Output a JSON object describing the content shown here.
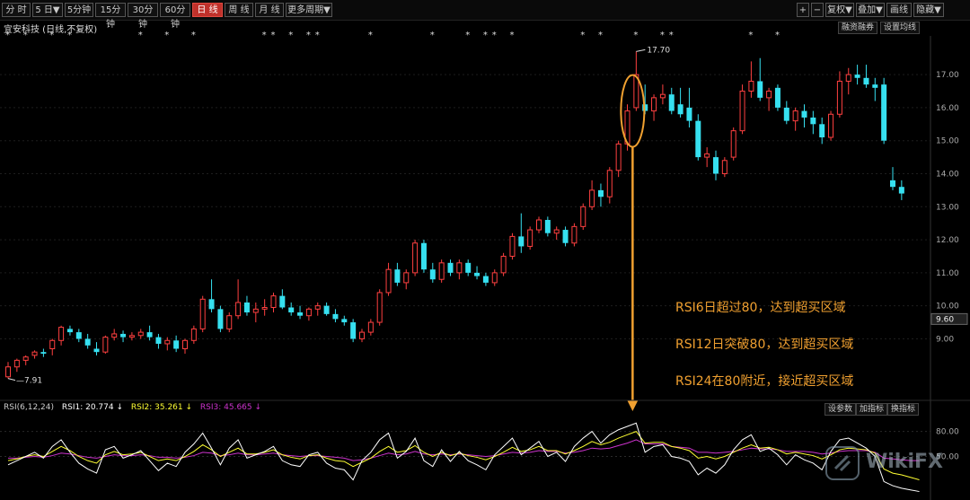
{
  "toolbar": {
    "tabs": [
      "分 时",
      "5 日▼",
      "5分钟",
      "15分钟",
      "30分钟",
      "60分钟",
      "日 线",
      "周 线",
      "月 线",
      "更多周期▼"
    ],
    "active_tab": "日 线",
    "right_buttons": [
      "+",
      "−",
      "复权▼",
      "叠加▼",
      "画线",
      "隐藏▼"
    ]
  },
  "stock_title": "宜安科技 (日线,不复权)",
  "right_tools": [
    "融资融券",
    "设置均线"
  ],
  "rsi_tools": [
    "设参数",
    "加指标",
    "换指标"
  ],
  "annotations": [
    "RSI6日超过80，达到超买区域",
    "RSI12日突破80，达到超买区域",
    "RSI24在80附近，接近超买区域"
  ],
  "rsi_header": {
    "name": "RSI(6,12,24)",
    "rsi1": "RSI1: 20.774 ↓",
    "rsi2": "RSI2: 35.261 ↓",
    "rsi3": "RSI3: 45.665 ↓"
  },
  "watermark": "WikiFX",
  "colors": {
    "up": "#ff4040",
    "down": "#36e0f0",
    "rsi1": "#ffffff",
    "rsi2": "#ffff33",
    "rsi3": "#cc33cc",
    "annotation": "#f0a030"
  },
  "chart_data": {
    "type": "candlestick",
    "ylim": [
      7.3,
      17.9
    ],
    "yticks": [
      "17.00",
      "16.00",
      "15.00",
      "14.00",
      "13.00",
      "12.00",
      "11.00",
      "10.00",
      "9.00"
    ],
    "current_price_label": "9.60",
    "high_label": "17.70",
    "low_label": "7.91",
    "ohlc": [
      [
        7.85,
        8.3,
        7.8,
        8.15
      ],
      [
        8.15,
        8.4,
        8.0,
        8.35
      ],
      [
        8.35,
        8.5,
        8.2,
        8.45
      ],
      [
        8.5,
        8.65,
        8.4,
        8.6
      ],
      [
        8.6,
        8.7,
        8.45,
        8.55
      ],
      [
        8.7,
        9.0,
        8.5,
        8.95
      ],
      [
        8.95,
        9.4,
        8.8,
        9.35
      ],
      [
        9.3,
        9.4,
        9.1,
        9.2
      ],
      [
        9.2,
        9.3,
        8.9,
        9.0
      ],
      [
        9.0,
        9.15,
        8.7,
        8.8
      ],
      [
        8.7,
        8.9,
        8.5,
        8.6
      ],
      [
        8.6,
        9.1,
        8.55,
        9.05
      ],
      [
        9.05,
        9.3,
        8.95,
        9.15
      ],
      [
        9.15,
        9.25,
        8.9,
        9.05
      ],
      [
        9.05,
        9.2,
        8.95,
        9.1
      ],
      [
        9.1,
        9.3,
        9.0,
        9.2
      ],
      [
        9.2,
        9.4,
        8.95,
        9.05
      ],
      [
        9.05,
        9.15,
        8.7,
        8.85
      ],
      [
        8.85,
        9.05,
        8.65,
        8.95
      ],
      [
        8.95,
        9.1,
        8.6,
        8.7
      ],
      [
        8.7,
        9.0,
        8.55,
        8.95
      ],
      [
        8.95,
        9.4,
        8.85,
        9.3
      ],
      [
        9.3,
        10.3,
        9.2,
        10.2
      ],
      [
        10.2,
        10.8,
        9.8,
        9.9
      ],
      [
        9.9,
        10.0,
        9.2,
        9.3
      ],
      [
        9.3,
        9.8,
        9.2,
        9.7
      ],
      [
        9.7,
        10.8,
        9.6,
        10.1
      ],
      [
        10.1,
        10.3,
        9.7,
        9.8
      ],
      [
        9.8,
        10.1,
        9.5,
        9.9
      ],
      [
        9.9,
        10.2,
        9.7,
        9.95
      ],
      [
        9.95,
        10.4,
        9.8,
        10.3
      ],
      [
        10.3,
        10.5,
        9.9,
        9.95
      ],
      [
        9.95,
        10.1,
        9.7,
        9.8
      ],
      [
        9.8,
        10.0,
        9.6,
        9.7
      ],
      [
        9.7,
        9.95,
        9.55,
        9.9
      ],
      [
        9.9,
        10.1,
        9.7,
        10.0
      ],
      [
        10.0,
        10.1,
        9.7,
        9.75
      ],
      [
        9.75,
        9.9,
        9.5,
        9.6
      ],
      [
        9.6,
        9.7,
        9.4,
        9.5
      ],
      [
        9.5,
        9.6,
        8.9,
        9.0
      ],
      [
        9.0,
        9.3,
        8.9,
        9.2
      ],
      [
        9.2,
        9.6,
        9.1,
        9.5
      ],
      [
        9.5,
        10.5,
        9.4,
        10.4
      ],
      [
        10.4,
        11.3,
        10.3,
        11.1
      ],
      [
        11.1,
        11.3,
        10.6,
        10.7
      ],
      [
        10.7,
        11.1,
        10.5,
        11.0
      ],
      [
        11.0,
        12.0,
        10.9,
        11.9
      ],
      [
        11.9,
        12.0,
        11.0,
        11.1
      ],
      [
        11.1,
        11.3,
        10.7,
        10.8
      ],
      [
        10.8,
        11.4,
        10.7,
        11.3
      ],
      [
        11.3,
        11.4,
        10.9,
        11.0
      ],
      [
        11.0,
        11.4,
        10.8,
        11.3
      ],
      [
        11.3,
        11.4,
        10.9,
        11.0
      ],
      [
        11.0,
        11.2,
        10.8,
        10.9
      ],
      [
        10.9,
        11.0,
        10.6,
        10.7
      ],
      [
        10.7,
        11.1,
        10.6,
        11.0
      ],
      [
        11.0,
        11.6,
        10.9,
        11.5
      ],
      [
        11.5,
        12.2,
        11.4,
        12.1
      ],
      [
        12.1,
        12.8,
        11.6,
        11.8
      ],
      [
        11.8,
        12.4,
        11.7,
        12.3
      ],
      [
        12.3,
        12.7,
        12.2,
        12.6
      ],
      [
        12.6,
        12.7,
        12.1,
        12.2
      ],
      [
        12.2,
        12.4,
        12.0,
        12.3
      ],
      [
        12.3,
        12.4,
        11.8,
        11.9
      ],
      [
        11.9,
        12.5,
        11.8,
        12.4
      ],
      [
        12.4,
        13.1,
        12.3,
        13.0
      ],
      [
        13.0,
        13.8,
        12.9,
        13.5
      ],
      [
        13.5,
        13.7,
        13.0,
        13.3
      ],
      [
        13.3,
        14.2,
        13.1,
        14.1
      ],
      [
        14.1,
        15.0,
        13.9,
        14.9
      ],
      [
        14.9,
        16.1,
        14.7,
        15.9
      ],
      [
        16.0,
        17.7,
        15.9,
        17.0
      ],
      [
        16.1,
        16.7,
        15.8,
        15.9
      ],
      [
        15.9,
        16.4,
        15.6,
        16.3
      ],
      [
        16.3,
        16.7,
        16.1,
        16.4
      ],
      [
        16.4,
        16.6,
        15.8,
        15.9
      ],
      [
        16.1,
        16.6,
        15.7,
        15.8
      ],
      [
        16.0,
        16.6,
        15.4,
        15.6
      ],
      [
        15.6,
        15.8,
        14.4,
        14.5
      ],
      [
        14.5,
        14.8,
        14.2,
        14.6
      ],
      [
        14.5,
        14.7,
        13.8,
        14.0
      ],
      [
        14.0,
        14.5,
        13.9,
        14.4
      ],
      [
        14.5,
        15.4,
        14.4,
        15.3
      ],
      [
        15.3,
        16.7,
        15.2,
        16.5
      ],
      [
        16.5,
        17.4,
        16.3,
        16.8
      ],
      [
        16.8,
        17.5,
        16.2,
        16.3
      ],
      [
        16.3,
        16.6,
        15.9,
        16.5
      ],
      [
        16.6,
        16.7,
        15.9,
        16.0
      ],
      [
        16.0,
        16.2,
        15.5,
        15.6
      ],
      [
        15.6,
        16.0,
        15.3,
        15.9
      ],
      [
        15.9,
        16.1,
        15.4,
        15.7
      ],
      [
        15.7,
        15.9,
        15.2,
        15.5
      ],
      [
        15.5,
        15.7,
        14.9,
        15.1
      ],
      [
        15.1,
        15.9,
        15.0,
        15.8
      ],
      [
        15.8,
        17.1,
        15.7,
        16.8
      ],
      [
        16.8,
        17.2,
        16.4,
        17.0
      ],
      [
        17.0,
        17.3,
        16.7,
        16.9
      ],
      [
        16.9,
        17.3,
        16.6,
        16.7
      ],
      [
        16.7,
        16.9,
        16.2,
        16.6
      ],
      [
        16.7,
        16.9,
        14.9,
        15.0
      ],
      [
        13.8,
        14.2,
        13.5,
        13.6
      ],
      [
        13.6,
        13.8,
        13.2,
        13.4
      ]
    ],
    "rsi1": [
      40,
      45,
      50,
      55,
      48,
      62,
      70,
      55,
      42,
      35,
      30,
      58,
      62,
      48,
      52,
      57,
      45,
      33,
      42,
      38,
      55,
      65,
      78,
      60,
      40,
      60,
      70,
      48,
      52,
      56,
      62,
      45,
      40,
      38,
      52,
      55,
      42,
      36,
      34,
      22,
      45,
      55,
      70,
      78,
      48,
      56,
      72,
      45,
      38,
      58,
      44,
      56,
      45,
      40,
      34,
      52,
      62,
      72,
      52,
      60,
      68,
      50,
      55,
      44,
      62,
      72,
      80,
      66,
      76,
      82,
      86,
      90,
      55,
      62,
      64,
      50,
      48,
      44,
      28,
      36,
      30,
      40,
      58,
      70,
      76,
      56,
      60,
      52,
      40,
      52,
      46,
      42,
      34,
      56,
      70,
      72,
      66,
      60,
      50,
      20,
      15,
      12,
      10,
      8
    ],
    "rsi2": [
      45,
      47,
      50,
      52,
      50,
      56,
      62,
      57,
      50,
      45,
      42,
      52,
      56,
      52,
      53,
      55,
      50,
      45,
      47,
      45,
      50,
      56,
      64,
      58,
      50,
      55,
      60,
      53,
      53,
      55,
      58,
      52,
      49,
      47,
      51,
      52,
      48,
      45,
      44,
      38,
      43,
      48,
      56,
      62,
      55,
      57,
      63,
      55,
      50,
      55,
      51,
      54,
      51,
      49,
      46,
      50,
      55,
      61,
      56,
      58,
      62,
      57,
      57,
      53,
      57,
      62,
      68,
      64,
      67,
      72,
      76,
      80,
      66,
      67,
      67,
      62,
      60,
      57,
      48,
      50,
      47,
      50,
      55,
      60,
      64,
      60,
      61,
      58,
      53,
      55,
      53,
      51,
      47,
      52,
      58,
      60,
      59,
      58,
      54,
      35,
      30,
      28,
      25,
      22
    ],
    "rsi3": [
      48,
      48,
      49,
      50,
      49,
      51,
      54,
      53,
      51,
      49,
      48,
      50,
      52,
      51,
      51,
      52,
      51,
      49,
      49,
      48,
      49,
      51,
      55,
      54,
      51,
      52,
      54,
      52,
      52,
      53,
      54,
      52,
      51,
      50,
      51,
      51,
      50,
      49,
      48,
      45,
      46,
      48,
      51,
      54,
      52,
      53,
      56,
      53,
      52,
      53,
      52,
      53,
      52,
      51,
      50,
      51,
      53,
      55,
      54,
      55,
      57,
      56,
      56,
      54,
      55,
      57,
      60,
      59,
      60,
      63,
      66,
      70,
      65,
      65,
      65,
      62,
      61,
      60,
      55,
      55,
      54,
      55,
      56,
      58,
      60,
      59,
      59,
      58,
      56,
      56,
      56,
      55,
      53,
      54,
      56,
      57,
      57,
      57,
      55,
      48,
      47,
      46,
      45,
      45
    ],
    "rsi_ylim": [
      0,
      100
    ],
    "rsi_ticks": [
      "80.00",
      "50.00"
    ],
    "star_markers": "*·*··*·*·······*··*··*·······**·*·**·····*······*···*·**·*·······*·*···*··**········*··*·"
  }
}
